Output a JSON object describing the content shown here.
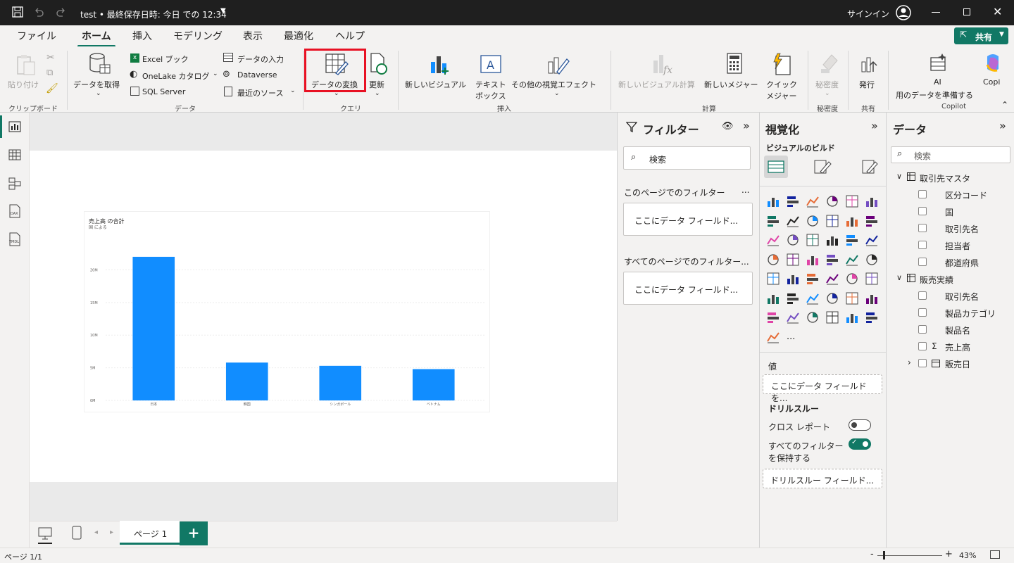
{
  "titlebar": {
    "title": "test • 最終保存日時: 今日 での 12:34",
    "signin": "サインイン"
  },
  "menu": [
    "ファイル",
    "ホーム",
    "挿入",
    "モデリング",
    "表示",
    "最適化",
    "ヘルプ"
  ],
  "share_label": "共有",
  "ribbon": {
    "paste": "貼り付け",
    "clipboard_group": "クリップボード",
    "get_data": "データを取得",
    "excel": "Excel ブック",
    "onelake": "OneLake カタログ",
    "sql": "SQL Server",
    "enter_data": "データの入力",
    "dataverse": "Dataverse",
    "recent": "最近のソース",
    "data_group": "データ",
    "transform": "データの変換",
    "refresh": "更新",
    "query_group": "クエリ",
    "new_visual": "新しいビジュアル",
    "textbox_1": "テキスト",
    "textbox_2": "ボックス",
    "more_visuals": "その他の視覚エフェクト",
    "insert_group": "挿入",
    "new_visual_calc": "新しいビジュアル計算",
    "new_measure": "新しいメジャー",
    "quick_measure_1": "クイック",
    "quick_measure_2": "メジャー",
    "calc_group": "計算",
    "sensitivity": "秘密度",
    "sensitivity_group": "秘密度",
    "publish": "発行",
    "share_group": "共有",
    "ai_1": "AI",
    "ai_2": "用のデータを準備する",
    "copilot": "Copi",
    "copilot_group": "Copilot"
  },
  "filters": {
    "title": "フィルター",
    "search_placeholder": "検索",
    "this_page": "このページでのフィルター",
    "all_pages": "すべてのページでのフィルター...",
    "drop_here": "ここにデータ フィールド...",
    "more": "..."
  },
  "viz": {
    "title": "視覚化",
    "build": "ビジュアルのビルド",
    "values": "値",
    "values_drop": "ここにデータ フィールドを...",
    "drillthrough": "ドリルスルー",
    "cross_report": "クロス レポート",
    "keep_filters_1": "すべてのフィルター",
    "keep_filters_2": "を保持する",
    "drill_drop": "ドリルスルー フィールド...",
    "more": "..."
  },
  "datapane": {
    "title": "データ",
    "search_placeholder": "検索",
    "tables": [
      {
        "name": "取引先マスタ",
        "fields": [
          "区分コード",
          "国",
          "取引先名",
          "担当者",
          "都道府県"
        ]
      },
      {
        "name": "販売実績",
        "fields": [
          "取引先名",
          "製品カテゴリ",
          "製品名",
          "売上高",
          "販売日"
        ]
      }
    ],
    "sigma": "Σ"
  },
  "pagetabs": {
    "page1": "ページ 1",
    "add": "+"
  },
  "status": {
    "page": "ページ 1/1",
    "zoom": "43%",
    "minus": "-",
    "plus": "+"
  },
  "colors": {
    "accent": "#117865",
    "bar": "#118DFF",
    "highlight": "#e81123"
  },
  "chart_data": {
    "type": "bar",
    "title": "売上高 の合計",
    "subtitle": "国 による",
    "categories": [
      "日本",
      "韓国",
      "シンガポール",
      "ベトナム"
    ],
    "values": [
      22000000,
      5800000,
      5300000,
      4800000
    ],
    "ytick_labels": [
      "0M",
      "5M",
      "10M",
      "15M",
      "20M"
    ],
    "ylim": [
      0,
      23500000
    ],
    "grid": true
  }
}
